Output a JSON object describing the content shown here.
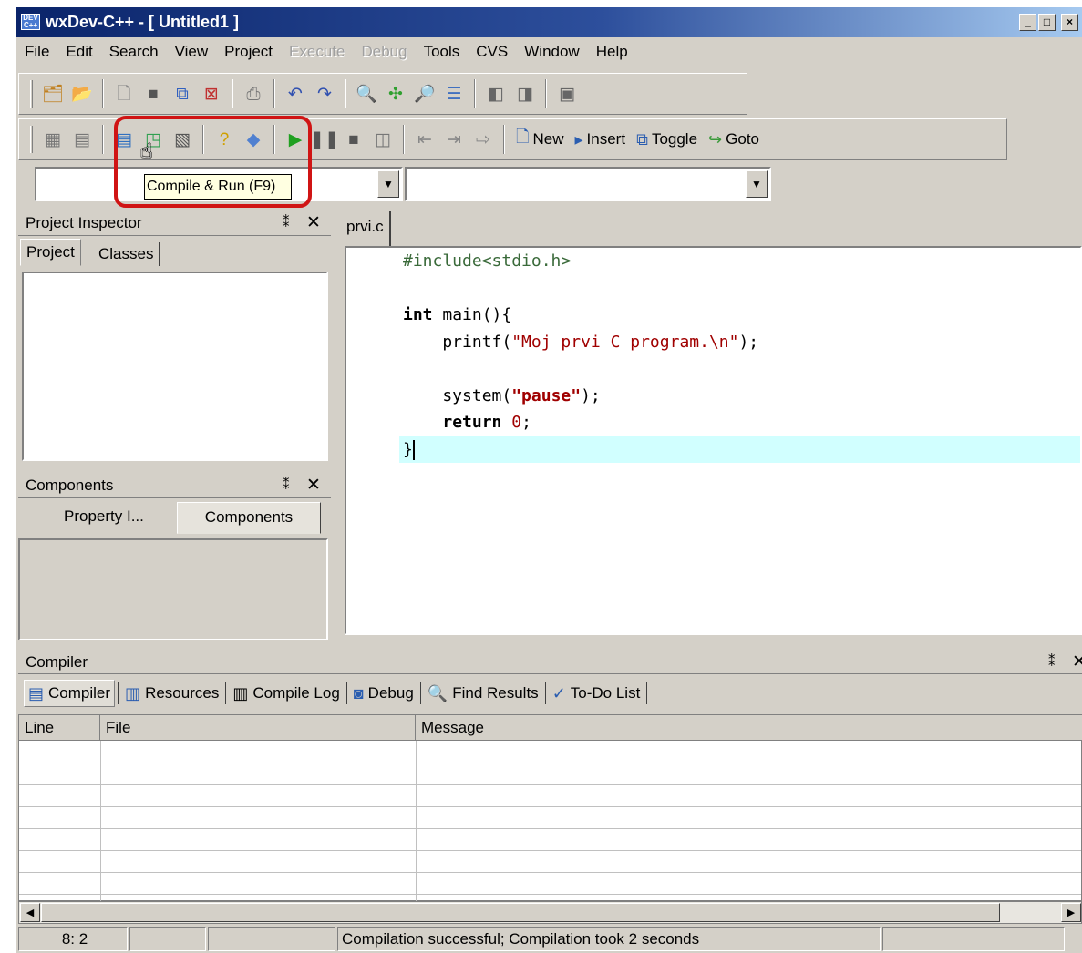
{
  "window": {
    "title": "wxDev-C++ - [ Untitled1 ]",
    "app_icon_text": "DEV\nC++",
    "controls": {
      "minimize": "_",
      "maximize": "□",
      "close": "×"
    }
  },
  "menu": [
    {
      "label": "File",
      "enabled": true
    },
    {
      "label": "Edit",
      "enabled": true
    },
    {
      "label": "Search",
      "enabled": true
    },
    {
      "label": "View",
      "enabled": true
    },
    {
      "label": "Project",
      "enabled": true
    },
    {
      "label": "Execute",
      "enabled": false
    },
    {
      "label": "Debug",
      "enabled": false
    },
    {
      "label": "Tools",
      "enabled": true
    },
    {
      "label": "CVS",
      "enabled": true
    },
    {
      "label": "Window",
      "enabled": true
    },
    {
      "label": "Help",
      "enabled": true
    }
  ],
  "toolbar2": {
    "new_label": "New",
    "insert_label": "Insert",
    "toggle_label": "Toggle",
    "goto_label": "Goto"
  },
  "tooltip": "Compile & Run (F9)",
  "project_inspector": {
    "title": "Project Inspector",
    "tabs": [
      "Project",
      "Classes"
    ]
  },
  "components_panel": {
    "title": "Components",
    "tabs": [
      "Property I...",
      "Components"
    ]
  },
  "editor": {
    "file_tab": "prvi.c",
    "active_line": 8
  },
  "compiler_panel": {
    "title": "Compiler",
    "tabs": [
      "Compiler",
      "Resources",
      "Compile Log",
      "Debug",
      "Find Results",
      "To-Do List"
    ],
    "columns": [
      "Line",
      "File",
      "Message"
    ]
  },
  "status": {
    "position": "8: 2",
    "message": "Compilation successful; Compilation took 2 seconds"
  },
  "panel_controls": {
    "pin": "⁑",
    "close": "✕"
  }
}
